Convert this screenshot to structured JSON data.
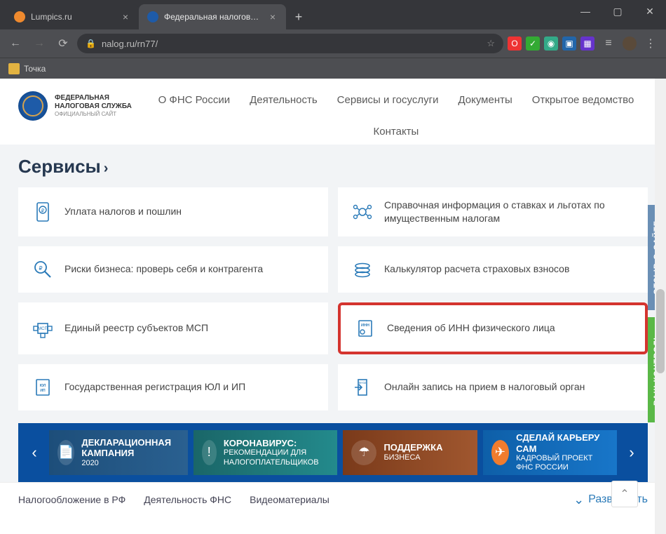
{
  "browser": {
    "tabs": [
      {
        "title": "Lumpics.ru",
        "active": false,
        "favicon": "#ef8a2e"
      },
      {
        "title": "Федеральная налоговая служба",
        "active": true,
        "favicon": "#1e5ba8"
      }
    ],
    "url": "nalog.ru/rn77/",
    "bookmark": "Точка"
  },
  "logo": {
    "line1": "ФЕДЕРАЛЬНАЯ",
    "line2": "НАЛОГОВАЯ СЛУЖБА",
    "sub": "ОФИЦИАЛЬНЫЙ САЙТ"
  },
  "nav": [
    "О ФНС России",
    "Деятельность",
    "Сервисы и госуслуги",
    "Документы",
    "Открытое ведомство",
    "Контакты"
  ],
  "section_title": "Сервисы",
  "cards": [
    {
      "label": "Уплата налогов и пошлин",
      "icon": "phone-ruble"
    },
    {
      "label": "Справочная информация о ставках и льготах по имущественным налогам",
      "icon": "info-circle"
    },
    {
      "label": "Риски бизнеса: проверь себя и контрагента",
      "icon": "magnify"
    },
    {
      "label": "Калькулятор расчета страховых взносов",
      "icon": "coins"
    },
    {
      "label": "Единый реестр субъектов МСП",
      "icon": "msp"
    },
    {
      "label": "Сведения об ИНН физического лица",
      "icon": "inn-doc",
      "highlight": true
    },
    {
      "label": "Государственная регистрация ЮЛ и ИП",
      "icon": "reg-doc"
    },
    {
      "label": "Онлайн запись на прием в налоговый орган",
      "icon": "door"
    }
  ],
  "banners": [
    {
      "title": "ДЕКЛАРАЦИОННАЯ КАМПАНИЯ",
      "sub": "2020"
    },
    {
      "title": "КОРОНАВИРУС:",
      "sub": "РЕКОМЕНДАЦИИ ДЛЯ НАЛОГОПЛАТЕЛЬЩИКОВ"
    },
    {
      "title": "ПОДДЕРЖКА",
      "sub": "БИЗНЕСА"
    },
    {
      "title": "СДЕЛАЙ КАРЬЕРУ САМ",
      "sub": "КАДРОВЫЙ ПРОЕКТ ФНС РОССИИ"
    }
  ],
  "footer": [
    "Налогообложение в РФ",
    "Деятельность ФНС",
    "Видеоматериалы"
  ],
  "footer_expand": "Развернуть",
  "side_tabs": [
    "ОТЗЫВ О САЙТЕ",
    "ВАШ КОНТРОЛЬ"
  ]
}
